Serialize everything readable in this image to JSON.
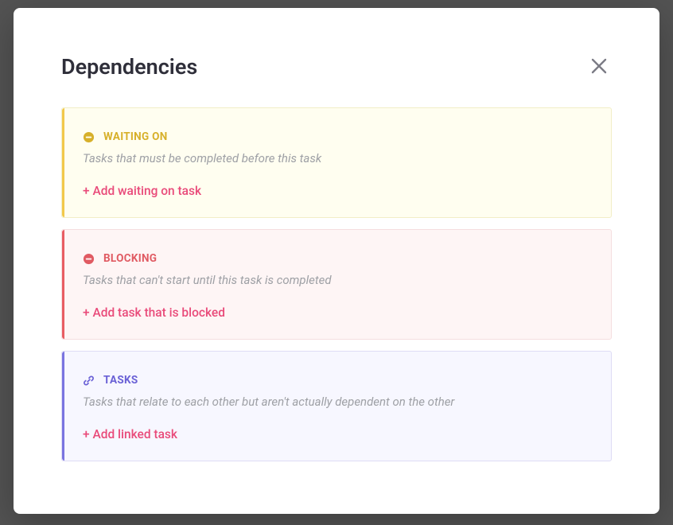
{
  "modal": {
    "title": "Dependencies",
    "close_aria": "Close"
  },
  "sections": {
    "waiting": {
      "label": "WAITING ON",
      "description": "Tasks that must be completed before this task",
      "add_label": "+ Add waiting on task"
    },
    "blocking": {
      "label": "BLOCKING",
      "description": "Tasks that can't start until this task is completed",
      "add_label": "+ Add task that is blocked"
    },
    "tasks": {
      "label": "TASKS",
      "description": "Tasks that relate to each other but aren't actually dependent on the other",
      "add_label": "+ Add linked task"
    }
  }
}
